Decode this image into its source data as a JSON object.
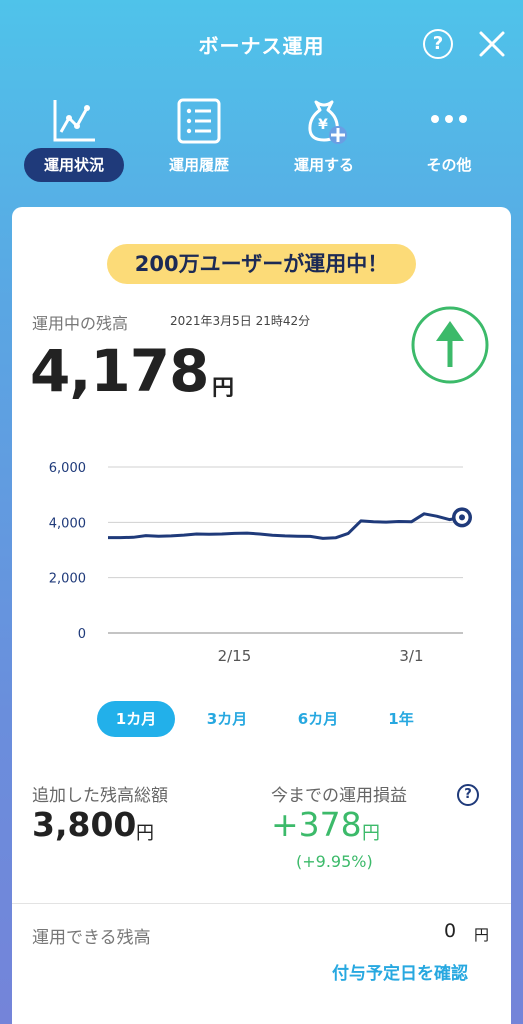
{
  "header": {
    "title": "ボーナス運用",
    "help": "?"
  },
  "tabs": [
    {
      "label": "運用状況",
      "icon": "line-chart-icon"
    },
    {
      "label": "運用履歴",
      "icon": "list-icon"
    },
    {
      "label": "運用する",
      "icon": "money-bag-plus-icon"
    },
    {
      "label": "その他",
      "icon": "more-icon"
    }
  ],
  "banner": "200万ユーザーが運用中！",
  "balance": {
    "label": "運用中の残高",
    "date": "2021年3月5日 21時42分",
    "value": "4,178",
    "unit": "円"
  },
  "colors": {
    "accent": "#27a8e0",
    "line": "#1f3a7a",
    "up": "#3cba6a",
    "banner": "#fcdb78"
  },
  "chart_data": {
    "type": "line",
    "x_ticks": [
      "2/15",
      "3/1"
    ],
    "y_ticks": [
      "6,000",
      "4,000",
      "2,000",
      "0"
    ],
    "ylim": [
      0,
      6000
    ],
    "x": [
      "2/5",
      "2/6",
      "2/7",
      "2/8",
      "2/9",
      "2/10",
      "2/11",
      "2/12",
      "2/13",
      "2/14",
      "2/15",
      "2/16",
      "2/17",
      "2/18",
      "2/19",
      "2/20",
      "2/21",
      "2/22",
      "2/23",
      "2/24",
      "2/25",
      "2/26",
      "2/27",
      "2/28",
      "3/1",
      "3/2",
      "3/3",
      "3/4",
      "3/5"
    ],
    "values": [
      3450,
      3450,
      3460,
      3520,
      3500,
      3510,
      3540,
      3580,
      3570,
      3580,
      3600,
      3610,
      3580,
      3530,
      3510,
      3500,
      3490,
      3420,
      3440,
      3600,
      4050,
      4020,
      4010,
      4030,
      4020,
      4310,
      4220,
      4100,
      4178
    ]
  },
  "periods": [
    "1カ月",
    "3カ月",
    "6カ月",
    "1年"
  ],
  "summary": {
    "added_label": "追加した残高総額",
    "added_value": "3,800",
    "added_unit": "円",
    "profit_label": "今までの運用損益",
    "profit_value": "+378",
    "profit_unit": "円",
    "profit_pct": "(+9.95%)"
  },
  "available": {
    "label": "運用できる残高",
    "value": "0",
    "unit": "円",
    "link": "付与予定日を確認"
  }
}
